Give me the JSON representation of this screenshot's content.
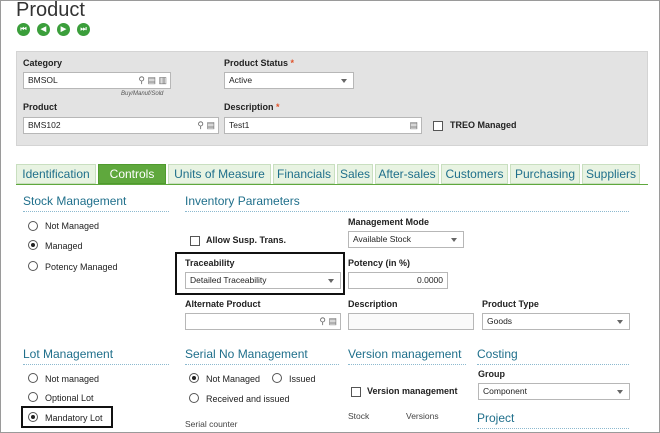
{
  "page": {
    "title": "Product"
  },
  "nav": {
    "first": "⏮",
    "prev": "◀",
    "next": "▶",
    "last": "⏭"
  },
  "header": {
    "category_label": "Category",
    "category_value": "BMSOL",
    "category_sub": "Buy/Manuf/Sold",
    "product_status_label": "Product Status",
    "product_status_required": "*",
    "product_status_value": "Active",
    "product_label": "Product",
    "product_value": "BMS102",
    "description_label": "Description",
    "description_required": "*",
    "description_value": "Test1",
    "treo_label": "TREO Managed"
  },
  "tabs": [
    "Identification",
    "Controls",
    "Units of Measure",
    "Financials",
    "Sales",
    "After-sales",
    "Customers",
    "Purchasing",
    "Suppliers"
  ],
  "stock": {
    "title": "Stock Management",
    "options": [
      "Not Managed",
      "Managed",
      "Potency Managed"
    ]
  },
  "inventory": {
    "title": "Inventory Parameters",
    "allow_susp": "Allow Susp. Trans.",
    "mgmt_mode_label": "Management Mode",
    "mgmt_mode_value": "Available Stock",
    "traceability_label": "Traceability",
    "traceability_value": "Detailed Traceability",
    "potency_label": "Potency (in %)",
    "potency_value": "0.0000",
    "alt_product_label": "Alternate Product",
    "description_label": "Description",
    "product_type_label": "Product Type",
    "product_type_value": "Goods"
  },
  "lot": {
    "title": "Lot Management",
    "options": [
      "Not managed",
      "Optional Lot",
      "Mandatory Lot"
    ]
  },
  "serial": {
    "title": "Serial No Management",
    "opt_not_managed": "Not Managed",
    "opt_issued": "Issued",
    "opt_received_issued": "Received and issued",
    "counter_label": "Serial counter"
  },
  "version": {
    "title": "Version management",
    "check_label": "Version management",
    "stock_label": "Stock",
    "versions_label": "Versions"
  },
  "costing": {
    "title": "Costing",
    "group_label": "Group",
    "group_value": "Component",
    "project_title": "Project"
  }
}
